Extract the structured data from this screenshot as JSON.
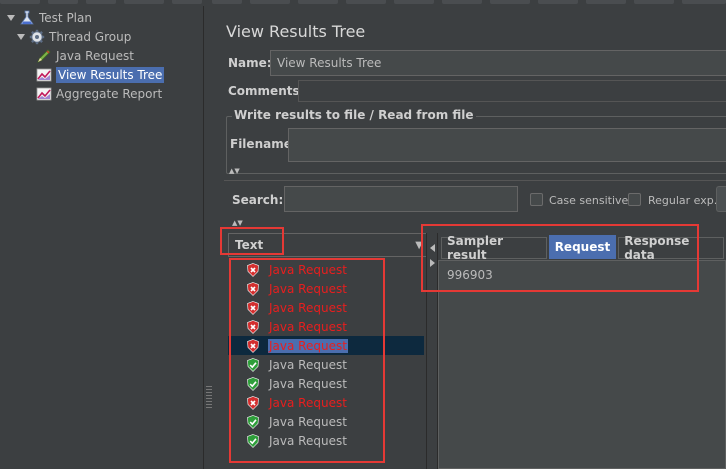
{
  "tree": {
    "items": [
      {
        "label": "Test Plan",
        "icon": "test-plan-icon",
        "selected": false
      },
      {
        "label": "Thread Group",
        "icon": "gear-icon",
        "selected": false
      },
      {
        "label": "Java Request",
        "icon": "sampler-pen-icon",
        "selected": false
      },
      {
        "label": "View Results Tree",
        "icon": "listener-chart-icon",
        "selected": true
      },
      {
        "label": "Aggregate Report",
        "icon": "listener-chart-icon",
        "selected": false
      }
    ]
  },
  "panel": {
    "title": "View Results Tree",
    "name_label": "Name:",
    "name_value": "View Results Tree",
    "comments_label": "Comments:",
    "write_results_title": "Write results to file / Read from file",
    "filename_label": "Filename",
    "search_label": "Search:",
    "case_sensitive_label": "Case sensitive",
    "regular_exp_label": "Regular exp."
  },
  "results": {
    "renderer": "Text",
    "rows": [
      {
        "label": "Java Request",
        "status": "fail"
      },
      {
        "label": "Java Request",
        "status": "fail"
      },
      {
        "label": "Java Request",
        "status": "fail"
      },
      {
        "label": "Java Request",
        "status": "fail"
      },
      {
        "label": "Java Request",
        "status": "fail",
        "selected": true
      },
      {
        "label": "Java Request",
        "status": "ok"
      },
      {
        "label": "Java Request",
        "status": "ok"
      },
      {
        "label": "Java Request",
        "status": "fail"
      },
      {
        "label": "Java Request",
        "status": "ok"
      },
      {
        "label": "Java Request",
        "status": "ok"
      }
    ]
  },
  "detail": {
    "tabs": [
      {
        "label": "Sampler result",
        "active": false
      },
      {
        "label": "Request",
        "active": true
      },
      {
        "label": "Response data",
        "active": false
      }
    ],
    "content": "996903"
  },
  "colors": {
    "fail": "#e81e1e",
    "ok": "#bbbbbb",
    "selection": "#4b6eaf",
    "highlight_box": "#e53935"
  }
}
